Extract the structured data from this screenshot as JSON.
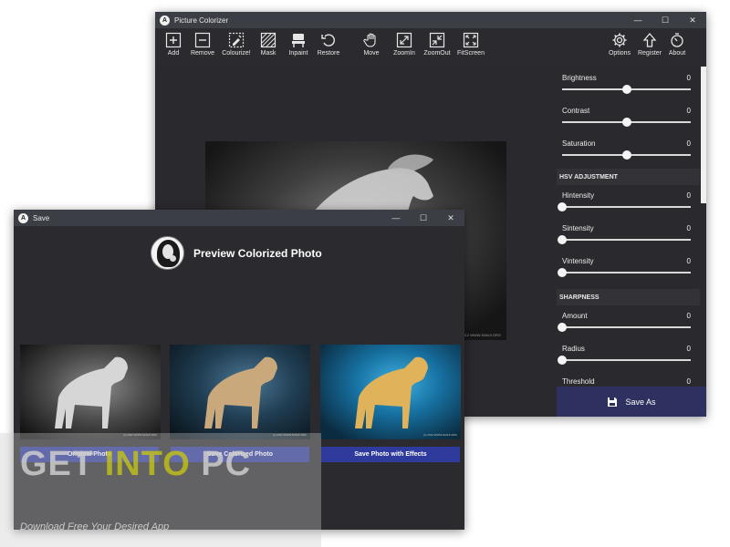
{
  "main_window": {
    "title": "Picture Colorizer",
    "logo_letter": "A",
    "controls": {
      "minimize": "—",
      "maximize": "☐",
      "close": "✕"
    },
    "toolbar": [
      {
        "label": "Add",
        "icon": "add-icon"
      },
      {
        "label": "Remove",
        "icon": "remove-icon"
      },
      {
        "label": "Colourize!",
        "icon": "colourize-icon"
      },
      {
        "label": "Mask",
        "icon": "mask-icon"
      },
      {
        "label": "Inpaint",
        "icon": "inpaint-icon"
      },
      {
        "label": "Restore",
        "icon": "restore-icon"
      },
      {
        "label": "Move",
        "icon": "hand-icon"
      },
      {
        "label": "ZoomIn",
        "icon": "zoom-in-icon"
      },
      {
        "label": "ZoomOut",
        "icon": "zoom-out-icon"
      },
      {
        "label": "FitScreen",
        "icon": "fit-screen-icon"
      },
      {
        "label": "Options",
        "icon": "gear-icon"
      },
      {
        "label": "Register",
        "icon": "register-icon"
      },
      {
        "label": "About",
        "icon": "about-icon"
      }
    ],
    "photo_caption": "(c) 2012 WWW.SANJI.ORG",
    "panel": {
      "sliders_top": [
        {
          "label": "Brightness",
          "value": "0",
          "level": 0.5
        },
        {
          "label": "Contrast",
          "value": "0",
          "level": 0.5
        },
        {
          "label": "Saturation",
          "value": "0",
          "level": 0.5
        }
      ],
      "hsv_header": "HSV ADJUSTMENT",
      "sliders_hsv": [
        {
          "label": "Hintensity",
          "value": "0",
          "level": 0
        },
        {
          "label": "Sintensity",
          "value": "0",
          "level": 0
        },
        {
          "label": "Vintensity",
          "value": "0",
          "level": 0
        }
      ],
      "sharpness_header": "SHARPNESS",
      "sliders_sharp": [
        {
          "label": "Amount",
          "value": "0",
          "level": 0
        },
        {
          "label": "Radius",
          "value": "0",
          "level": 0
        },
        {
          "label": "Threshold",
          "value": "0",
          "level": 0
        }
      ],
      "save_as_label": "Save As"
    }
  },
  "save_window": {
    "title": "Save",
    "logo_letter": "A",
    "controls": {
      "minimize": "—",
      "maximize": "☐",
      "close": "✕"
    },
    "heading": "Preview Colorized Photo",
    "thumb_caption": "(c) 2012 WWW.SANJI.ORG",
    "buttons": {
      "original": "Original Photo",
      "colorized": "Save Colorized Photo",
      "effects": "Save Photo with Effects"
    }
  },
  "watermark": {
    "get": "GET ",
    "into": "INTO",
    "pc": " PC",
    "tagline": "Download Free Your Desired App"
  },
  "colors": {
    "window_bg": "#2b2a2e",
    "titlebar": "#3b3e44",
    "accent_button": "#2e3a9c",
    "save_as_bg": "#2e3160"
  }
}
